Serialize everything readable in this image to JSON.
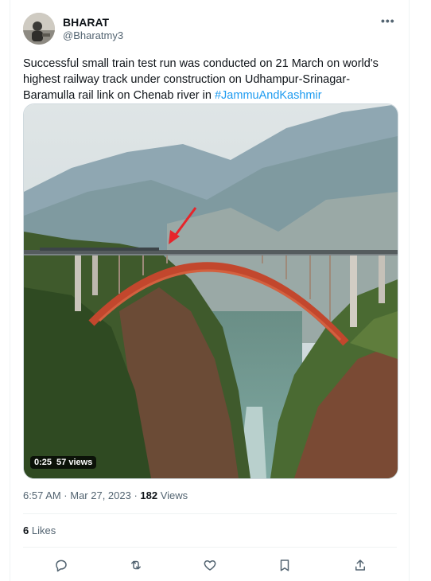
{
  "tweet": {
    "author_name": "BHARAT",
    "author_handle": "@Bharatmy3",
    "text_main": "Successful small train test run was conducted on 21 March on world's highest railway track under construction on Udhampur-Srinagar-Baramulla rail link on Chenab river in ",
    "hashtag": "#JammuAndKashmir",
    "video": {
      "duration": "0:25",
      "views": "57 views"
    },
    "timestamp": "6:57 AM · Mar 27, 2023",
    "separator": " · ",
    "views_count": "182",
    "views_label": " Views",
    "likes_count": "6",
    "likes_label": " Likes"
  },
  "icons": {
    "more": "more-horizontal-icon",
    "reply": "reply-icon",
    "retweet": "retweet-icon",
    "like": "heart-icon",
    "bookmark": "bookmark-icon",
    "share": "share-icon"
  },
  "colors": {
    "link": "#1d9bf0",
    "secondary": "#536471",
    "primary": "#0f1419",
    "bridge": "#c2472d"
  }
}
